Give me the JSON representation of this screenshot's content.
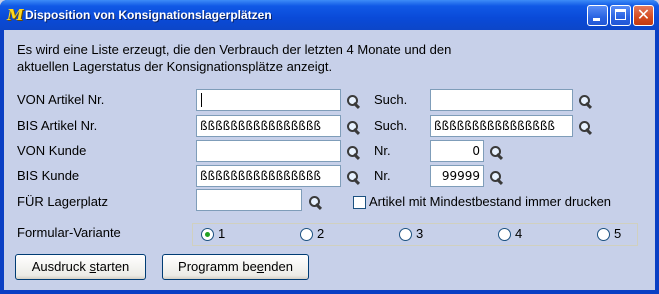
{
  "window": {
    "title": "Disposition von Konsignationslagerplätzen",
    "app_icon_glyph": "M",
    "controls": [
      "minimize-icon",
      "maximize-icon",
      "close-icon"
    ]
  },
  "description": {
    "line1": "Es wird eine Liste erzeugt, die den Verbrauch der letzten 4 Monate und den",
    "line2": "aktuellen Lagerstatus der Konsignationsplätze anzeigt."
  },
  "form": {
    "von_artikel_label": "VON Artikel Nr.",
    "von_artikel_value": "",
    "bis_artikel_label": "BIS Artikel Nr.",
    "bis_artikel_value": "ßßßßßßßßßßßßßßßß",
    "von_kunde_label": "VON Kunde",
    "von_kunde_value": "",
    "bis_kunde_label": "BIS Kunde",
    "bis_kunde_value": "ßßßßßßßßßßßßßßßß",
    "fuer_lagerplatz_label": "FÜR Lagerplatz",
    "fuer_lagerplatz_value": "",
    "such1_label": "Such.",
    "such1_value": "",
    "such2_label": "Such.",
    "such2_value": "ßßßßßßßßßßßßßßßß",
    "nr1_label": "Nr.",
    "nr1_value": "0",
    "nr2_label": "Nr.",
    "nr2_value": "99999",
    "mindestbestand_label": "Artikel mit Mindestbestand immer drucken",
    "mindestbestand_checked": false
  },
  "variant": {
    "label": "Formular-Variante",
    "options": [
      "1",
      "2",
      "3",
      "4",
      "5"
    ],
    "selected": "1"
  },
  "buttons": {
    "print_pre": "Ausdruck ",
    "print_accel": "s",
    "print_post": "tarten",
    "end_pre": "Programm be",
    "end_accel": "e",
    "end_post": "nden"
  },
  "colors": {
    "titlebar": "#0a4ad8",
    "client_bg": "#c7d0e9",
    "radio_dot": "#21a121",
    "field_border": "#7f9db9"
  }
}
